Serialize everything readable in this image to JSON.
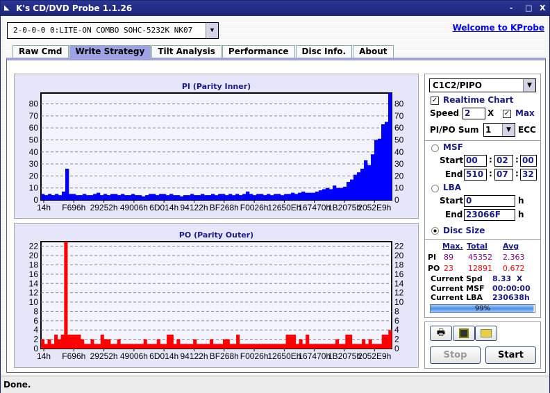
{
  "window": {
    "title": "K's CD/DVD Probe 1.1.26",
    "minimize": "-",
    "maximize": "□",
    "close": "X"
  },
  "drive": {
    "selected": "2-0-0-0 0:LITE-ON COMBO SOHC-5232K NK07"
  },
  "welcome_link": "Welcome to KProbe",
  "tabs": [
    {
      "label": "Raw Cmd"
    },
    {
      "label": "Write Strategy",
      "active": true
    },
    {
      "label": "Tilt Analysis"
    },
    {
      "label": "Performance"
    },
    {
      "label": "Disc Info."
    },
    {
      "label": "About"
    }
  ],
  "controls": {
    "mode": "C1C2/PIPO",
    "realtime_chart": "Realtime Chart",
    "realtime_checked": true,
    "speed_label": "Speed",
    "speed_value": "2",
    "speed_unit": "X",
    "max_label": "Max",
    "max_checked": true,
    "sum_label": "PI/PO Sum",
    "sum_value": "1",
    "ecc_label": "ECC",
    "msf_label": "MSF",
    "start_label": "Start",
    "end_label": "End",
    "msf_start": [
      "00",
      "02",
      "00"
    ],
    "msf_end": [
      "510",
      "07",
      "32"
    ],
    "colon": ":",
    "lba_label": "LBA",
    "lba_start": "0",
    "lba_end": "23066F",
    "h": "h",
    "disc_size_label": "Disc Size",
    "selected_range": "Disc Size"
  },
  "stats": {
    "headers": [
      "Max.",
      "Total",
      "Avg"
    ],
    "pi": {
      "label": "PI",
      "max": "89",
      "total": "45352",
      "avg": "2.363",
      "color": "#800080"
    },
    "po": {
      "label": "PO",
      "max": "23",
      "total": "12891",
      "avg": "0.672",
      "color": "#ff0000"
    },
    "current_spd_label": "Current Spd",
    "current_spd": "8.33  X",
    "current_msf_label": "Current MSF",
    "current_msf": "00:00:00",
    "current_lba_label": "Current LBA",
    "current_lba": "230638h",
    "progress_text": "99%",
    "progress": 0.99
  },
  "buttons": {
    "print_icon": "printer-icon",
    "save_icon": "floppy-icon",
    "open_icon": "folder-icon",
    "stop": "Stop",
    "start": "Start"
  },
  "status": "Done.",
  "chart_data": [
    {
      "type": "bar",
      "title": "PI (Parity Inner)",
      "color": "#0000ff",
      "ylim": [
        0,
        89
      ],
      "yticks": [
        0,
        10,
        20,
        30,
        40,
        50,
        60,
        70,
        80
      ],
      "xtick_labels": [
        "14h",
        "F696h",
        "29252h",
        "49006h",
        "6D014h",
        "94122h",
        "BF268h",
        "F0026h",
        "12650Eh",
        "167470h",
        "1B2075h",
        "2052E9h"
      ],
      "grid": true,
      "values": [
        5,
        4,
        5,
        4,
        5,
        4,
        7,
        26,
        5,
        5,
        4,
        4,
        5,
        4,
        4,
        5,
        6,
        4,
        5,
        4,
        5,
        5,
        4,
        5,
        4,
        4,
        5,
        4,
        4,
        3,
        4,
        5,
        5,
        4,
        5,
        5,
        4,
        5,
        4,
        4,
        3,
        4,
        4,
        5,
        4,
        4,
        5,
        4,
        4,
        5,
        4,
        5,
        5,
        4,
        5,
        4,
        5,
        4,
        5,
        7,
        5,
        4,
        5,
        5,
        4,
        5,
        4,
        5,
        5,
        4,
        5,
        5,
        6,
        5,
        6,
        7,
        6,
        6,
        6,
        7,
        8,
        9,
        10,
        9,
        12,
        10,
        10,
        11,
        15,
        17,
        21,
        23,
        26,
        33,
        29,
        38,
        50,
        51,
        63,
        65,
        89
      ]
    },
    {
      "type": "bar",
      "title": "PO (Parity Outer)",
      "color": "#ff0000",
      "ylim": [
        0,
        23
      ],
      "yticks": [
        0,
        2,
        4,
        6,
        8,
        10,
        12,
        14,
        16,
        18,
        20,
        22
      ],
      "xtick_labels": [
        "14h",
        "F696h",
        "29252h",
        "49006h",
        "6D014h",
        "94122h",
        "BF268h",
        "F0026h",
        "12650Eh",
        "167470h",
        "1B2075h",
        "2052E9h"
      ],
      "grid": true,
      "values": [
        2,
        1,
        2,
        1,
        3,
        2,
        3,
        23,
        3,
        3,
        3,
        3,
        2,
        1,
        1,
        2,
        1,
        1,
        3,
        2,
        2,
        1,
        1,
        2,
        1,
        1,
        1,
        1,
        1,
        1,
        1,
        2,
        1,
        1,
        1,
        2,
        1,
        1,
        3,
        3,
        1,
        2,
        1,
        1,
        1,
        1,
        2,
        1,
        1,
        1,
        1,
        2,
        1,
        1,
        1,
        2,
        2,
        1,
        1,
        3,
        1,
        1,
        1,
        1,
        1,
        1,
        1,
        1,
        1,
        1,
        1,
        1,
        1,
        1,
        3,
        3,
        3,
        1,
        2,
        1,
        3,
        1,
        1,
        1,
        1,
        1,
        1,
        1,
        1,
        2,
        1,
        1,
        3,
        3,
        1,
        1,
        1,
        2,
        1,
        2,
        1,
        1,
        1,
        3,
        3,
        4
      ]
    }
  ]
}
